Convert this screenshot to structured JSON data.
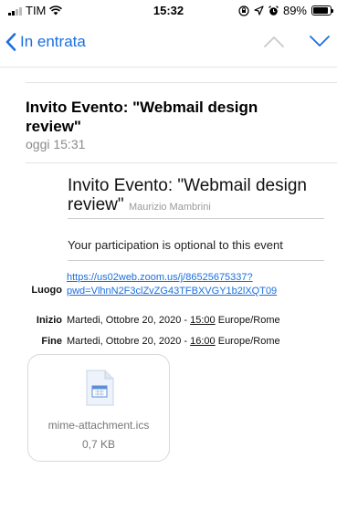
{
  "status_bar": {
    "carrier": "TIM",
    "time": "15:32",
    "battery": "89%",
    "battery_level": 0.89
  },
  "nav": {
    "back_label": "In entrata"
  },
  "email": {
    "subject": "Invito Evento: \"Webmail design review\"",
    "date": "oggi 15:31"
  },
  "invite": {
    "title": "Invito Evento: \"Webmail design review\"",
    "organizer": "Maurizio Mambrini",
    "participation": "Your participation is optional to this event",
    "location_label": "Luogo",
    "location_url_line1": "https://us02web.zoom.us/j/86525675337?",
    "location_url_line2": "pwd=VlhnN2F3clZvZG43TFBXVGY1b2lXQT09",
    "start_label": "Inizio",
    "start_date": "Martedi, Ottobre 20, 2020 - ",
    "start_time": "15:00",
    "start_tz": " Europe/Rome",
    "end_label": "Fine",
    "end_date": "Martedi, Ottobre 20, 2020 - ",
    "end_time": "16:00",
    "end_tz": " Europe/Rome"
  },
  "attachment": {
    "name": "mime-attachment.ics",
    "size": "0,7 KB",
    "icon": "calendar-file-icon"
  },
  "colors": {
    "accent": "#1a6fe0",
    "muted": "#8a8a8a"
  }
}
